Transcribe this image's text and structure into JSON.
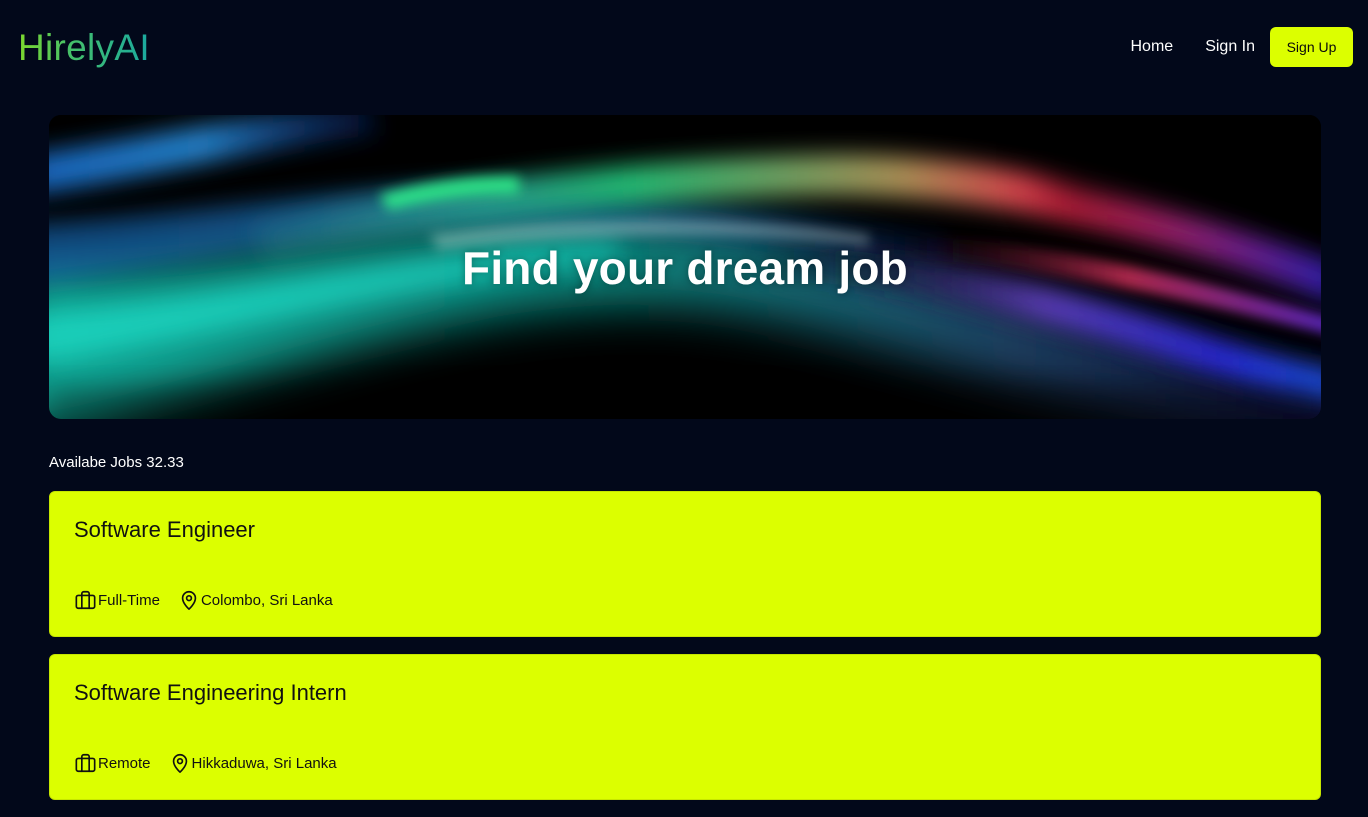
{
  "brand": {
    "name": "HirelyAI"
  },
  "nav": {
    "home_label": "Home",
    "signin_label": "Sign In",
    "signup_label": "Sign Up"
  },
  "hero": {
    "title": "Find your dream job"
  },
  "jobs": {
    "count_label": "Availabe Jobs 32.33",
    "items": [
      {
        "title": "Software Engineer",
        "type": "Full-Time",
        "location": "Colombo, Sri Lanka"
      },
      {
        "title": "Software Engineering Intern",
        "type": "Remote",
        "location": "Hikkaduwa, Sri Lanka"
      }
    ]
  },
  "icons": {
    "job_type": "briefcase-icon",
    "location": "map-pin-icon"
  },
  "colors": {
    "background": "#02081a",
    "accent": "#dcff00",
    "logo_gradient_start": "#7dd82e",
    "logo_gradient_end": "#1aa9a0"
  }
}
